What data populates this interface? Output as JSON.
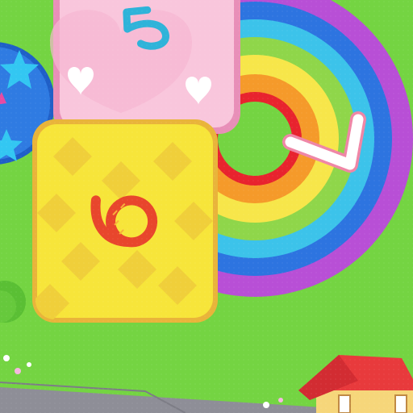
{
  "game": {
    "tiles": [
      {
        "number": "5",
        "theme": "pink-hearts",
        "fill": "#f9c6dc",
        "border": "#e88fb8",
        "number_color": "#2fb3d9"
      },
      {
        "number": "6",
        "theme": "yellow-diamonds",
        "fill": "#f7e53a",
        "border": "#e9b43a",
        "number_color": "#e8462c"
      },
      {
        "number": "7",
        "theme": "rainbow-arc",
        "number_color": "#ffffff",
        "number_outline": "#ef86a6"
      }
    ],
    "rainbow_colors": [
      "#e8232e",
      "#f59a2a",
      "#f7e64a",
      "#8fd64a",
      "#3cc3ea",
      "#2d74e0",
      "#b84fd6"
    ],
    "circle_tile": {
      "fill": "#2f7be2",
      "star_color": "#33c7f2"
    },
    "grass_color": "#74d442",
    "house": {
      "roof_color": "#e83a3c",
      "wall_color": "#f6d67a"
    },
    "path_color": "#8e8e97"
  }
}
